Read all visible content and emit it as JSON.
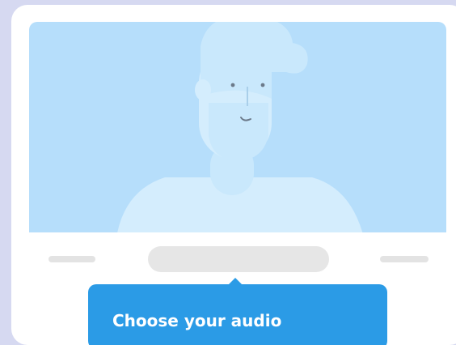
{
  "tooltip": {
    "title": "Choose your audio"
  },
  "icons": {
    "illustration": "person-avatar-illustration"
  },
  "colors": {
    "background": "#d6d9f1",
    "card": "#ffffff",
    "screen": "#b6defb",
    "figure": "#d4edfd",
    "tooltip": "#2b9be6"
  }
}
